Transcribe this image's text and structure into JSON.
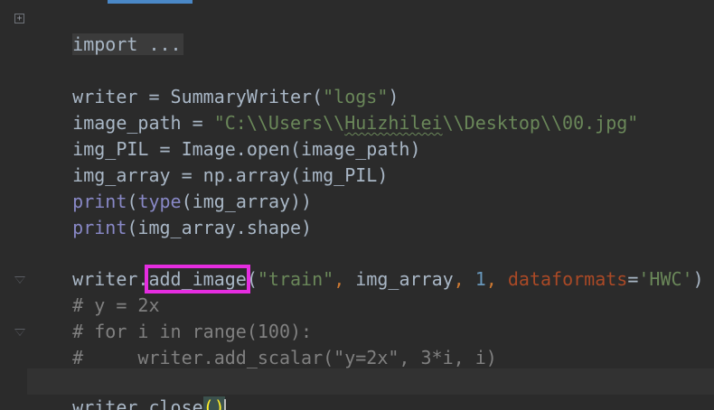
{
  "editor": {
    "lines": {
      "import_collapsed": "import ...",
      "writer_assign": {
        "var": "writer = SummaryWriter(",
        "arg": "\"logs\"",
        "close": ")"
      },
      "image_path": {
        "prefix": "image_path = ",
        "str_a": "\"C:\\\\Users\\\\",
        "str_b": "Huizhilei",
        "str_c": "\\\\Desktop\\\\00.jpg\""
      },
      "img_pil": "img_PIL = Image.open(image_path)",
      "img_array": "img_array = np.array(img_PIL)",
      "print_type": {
        "fn": "print",
        "open": "(",
        "fn2": "type",
        "rest": "(img_array))"
      },
      "print_shape": {
        "fn": "print",
        "rest": "(img_array.shape)"
      },
      "add_image": {
        "obj": "writer.",
        "method": "add_image",
        "open": "(",
        "str": "\"train\"",
        "comma1": ", ",
        "arg2": "img_array",
        "comma2": ", ",
        "num": "1",
        "comma3": ", ",
        "param": "dataformats",
        "eq": "=",
        "str2": "'HWC'",
        "close": ")"
      },
      "comment1": "# y = 2x",
      "comment2": "# for i in range(100):",
      "comment3": "#     writer.add_scalar(\"y=2x\", 3*i, i)",
      "close_line": {
        "text": "writer.close",
        "open": "(",
        "close": ")"
      }
    },
    "icons": [
      "fold-expand-icon",
      "fold-end-icon"
    ],
    "colors": {
      "background": "#2b2b2b",
      "default_text": "#a9b7c6",
      "string": "#6a8759",
      "keyword": "#cc7832",
      "number": "#6897bb",
      "builtin": "#8888c6",
      "param": "#aa4926",
      "comment": "#808080",
      "highlight_box": "#e52de0"
    }
  }
}
